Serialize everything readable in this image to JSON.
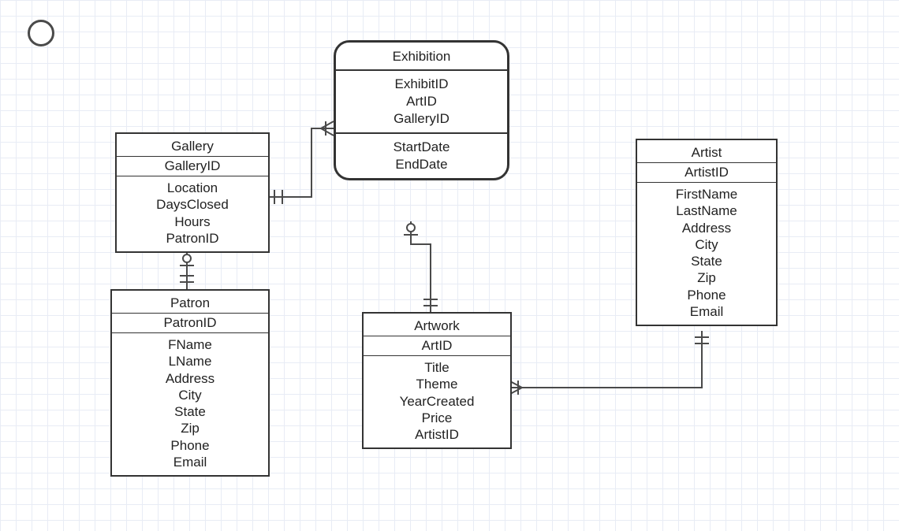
{
  "entities": {
    "gallery": {
      "title": "Gallery",
      "pk": "GalleryID",
      "attrs": [
        "Location",
        "DaysClosed",
        "Hours",
        "PatronID"
      ]
    },
    "patron": {
      "title": "Patron",
      "pk": "PatronID",
      "attrs": [
        "FName",
        "LName",
        "Address",
        "City",
        "State",
        "Zip",
        "Phone",
        "Email"
      ]
    },
    "exhibition": {
      "title": "Exhibition",
      "pks": [
        "ExhibitID",
        "ArtID",
        "GalleryID"
      ],
      "attrs": [
        "StartDate",
        "EndDate"
      ]
    },
    "artwork": {
      "title": "Artwork",
      "pk": "ArtID",
      "attrs": [
        "Title",
        "Theme",
        "YearCreated",
        "Price",
        "ArtistID"
      ]
    },
    "artist": {
      "title": "Artist",
      "pk": "ArtistID",
      "attrs": [
        "FirstName",
        "LastName",
        "Address",
        "City",
        "State",
        "Zip",
        "Phone",
        "Email"
      ]
    }
  }
}
